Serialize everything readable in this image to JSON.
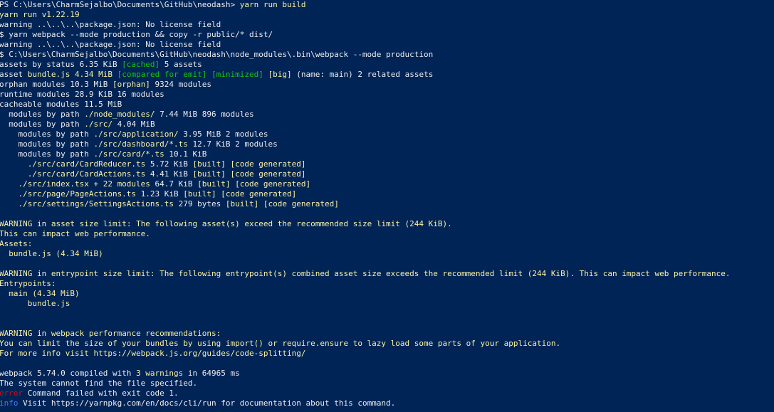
{
  "terminal": {
    "lines": [
      [
        {
          "t": "PS C:\\Users\\CharmSejalbo\\Documents\\GitHub\\neodash> ",
          "c": "w"
        },
        {
          "t": "yarn run build",
          "c": "y"
        }
      ],
      [
        {
          "t": "yarn run v1.22.19",
          "c": "y"
        }
      ],
      [
        {
          "t": "warning ..\\..\\..\\package.json: No license field",
          "c": "w"
        }
      ],
      [
        {
          "t": "$ yarn webpack --mode production && copy -r public/* dist/",
          "c": "w"
        }
      ],
      [
        {
          "t": "warning ..\\..\\..\\package.json: No license field",
          "c": "w"
        }
      ],
      [
        {
          "t": "$ C:\\Users\\CharmSejalbo\\Documents\\GitHub\\neodash\\node_modules\\.bin\\webpack --mode production",
          "c": "w"
        }
      ],
      [
        {
          "t": "assets by status 6.35 KiB ",
          "c": "w"
        },
        {
          "t": "[cached]",
          "c": "g"
        },
        {
          "t": " 5 assets",
          "c": "w"
        }
      ],
      [
        {
          "t": "asset ",
          "c": "w"
        },
        {
          "t": "bundle.js 4.34 MiB",
          "c": "y"
        },
        {
          "t": " ",
          "c": "w"
        },
        {
          "t": "[compared for emit]",
          "c": "g"
        },
        {
          "t": " ",
          "c": "w"
        },
        {
          "t": "[minimized]",
          "c": "g"
        },
        {
          "t": " ",
          "c": "w"
        },
        {
          "t": "[big]",
          "c": "y"
        },
        {
          "t": " (name: main) 2 related assets",
          "c": "w"
        }
      ],
      [
        {
          "t": "orphan modules 10.3 MiB ",
          "c": "w"
        },
        {
          "t": "[orphan]",
          "c": "y"
        },
        {
          "t": " 9324 modules",
          "c": "w"
        }
      ],
      [
        {
          "t": "runtime modules 28.9 KiB 16 modules",
          "c": "w"
        }
      ],
      [
        {
          "t": "cacheable modules 11.5 MiB",
          "c": "w"
        }
      ],
      [
        {
          "t": "  modules by path ",
          "c": "w"
        },
        {
          "t": "./node_modules/",
          "c": "y"
        },
        {
          "t": " 7.44 MiB 896 modules",
          "c": "w"
        }
      ],
      [
        {
          "t": "  modules by path ",
          "c": "w"
        },
        {
          "t": "./src/",
          "c": "y"
        },
        {
          "t": " 4.04 MiB",
          "c": "w"
        }
      ],
      [
        {
          "t": "    modules by path ",
          "c": "w"
        },
        {
          "t": "./src/application/",
          "c": "y"
        },
        {
          "t": " 3.95 MiB 2 modules",
          "c": "w"
        }
      ],
      [
        {
          "t": "    modules by path ",
          "c": "w"
        },
        {
          "t": "./src/dashboard/*.ts",
          "c": "y"
        },
        {
          "t": " 12.7 KiB 2 modules",
          "c": "w"
        }
      ],
      [
        {
          "t": "    modules by path ",
          "c": "w"
        },
        {
          "t": "./src/card/*.ts",
          "c": "y"
        },
        {
          "t": " 10.1 KiB",
          "c": "w"
        }
      ],
      [
        {
          "t": "      ./src/card/CardReducer.ts",
          "c": "y"
        },
        {
          "t": " 5.72 KiB ",
          "c": "w"
        },
        {
          "t": "[built] [code generated]",
          "c": "y"
        }
      ],
      [
        {
          "t": "      ./src/card/CardActions.ts",
          "c": "y"
        },
        {
          "t": " 4.41 KiB ",
          "c": "w"
        },
        {
          "t": "[built] [code generated]",
          "c": "y"
        }
      ],
      [
        {
          "t": "    ./src/index.tsx + 22 modules",
          "c": "y"
        },
        {
          "t": " 64.7 KiB ",
          "c": "w"
        },
        {
          "t": "[built] [code generated]",
          "c": "y"
        }
      ],
      [
        {
          "t": "    ./src/page/PageActions.ts",
          "c": "y"
        },
        {
          "t": " 1.23 KiB ",
          "c": "w"
        },
        {
          "t": "[built] [code generated]",
          "c": "y"
        }
      ],
      [
        {
          "t": "    ./src/settings/SettingsActions.ts",
          "c": "y"
        },
        {
          "t": " 279 bytes ",
          "c": "w"
        },
        {
          "t": "[built] [code generated]",
          "c": "y"
        }
      ],
      [
        {
          "t": "",
          "c": "w"
        }
      ],
      [
        {
          "t": "WARNING",
          "c": "y"
        },
        {
          "t": " in ",
          "c": "w"
        },
        {
          "t": "asset size limit: The following asset(s) exceed the recommended size limit (244 KiB).",
          "c": "y"
        }
      ],
      [
        {
          "t": "This can impact web performance.",
          "c": "y"
        }
      ],
      [
        {
          "t": "Assets:",
          "c": "y"
        }
      ],
      [
        {
          "t": "  bundle.js (4.34 MiB)",
          "c": "y"
        }
      ],
      [
        {
          "t": "",
          "c": "w"
        }
      ],
      [
        {
          "t": "WARNING",
          "c": "y"
        },
        {
          "t": " in ",
          "c": "w"
        },
        {
          "t": "entrypoint size limit: The following entrypoint(s) combined asset size exceeds the recommended limit (244 KiB). This can impact web performance.",
          "c": "y"
        }
      ],
      [
        {
          "t": "Entrypoints:",
          "c": "y"
        }
      ],
      [
        {
          "t": "  main (4.34 MiB)",
          "c": "y"
        }
      ],
      [
        {
          "t": "      bundle.js",
          "c": "y"
        }
      ],
      [
        {
          "t": "",
          "c": "w"
        }
      ],
      [
        {
          "t": "",
          "c": "w"
        }
      ],
      [
        {
          "t": "WARNING",
          "c": "y"
        },
        {
          "t": " in ",
          "c": "w"
        },
        {
          "t": "webpack performance recommendations:",
          "c": "y"
        }
      ],
      [
        {
          "t": "You can limit the size of your bundles by using import() or require.ensure to lazy load some parts of your application.",
          "c": "y"
        }
      ],
      [
        {
          "t": "For more info visit https://webpack.js.org/guides/code-splitting/",
          "c": "y"
        }
      ],
      [
        {
          "t": "",
          "c": "w"
        }
      ],
      [
        {
          "t": "webpack 5.74.0 compiled with ",
          "c": "w"
        },
        {
          "t": "3 warnings",
          "c": "y"
        },
        {
          "t": " in 64965 ms",
          "c": "w"
        }
      ],
      [
        {
          "t": "The system cannot find the file specified.",
          "c": "w"
        }
      ],
      [
        {
          "t": "error",
          "c": "r"
        },
        {
          "t": " Command failed with exit code 1.",
          "c": "w"
        }
      ],
      [
        {
          "t": "info",
          "c": "b"
        },
        {
          "t": " Visit https://yarnpkg.com/en/docs/cli/run for documentation about this command.",
          "c": "w"
        }
      ]
    ]
  }
}
